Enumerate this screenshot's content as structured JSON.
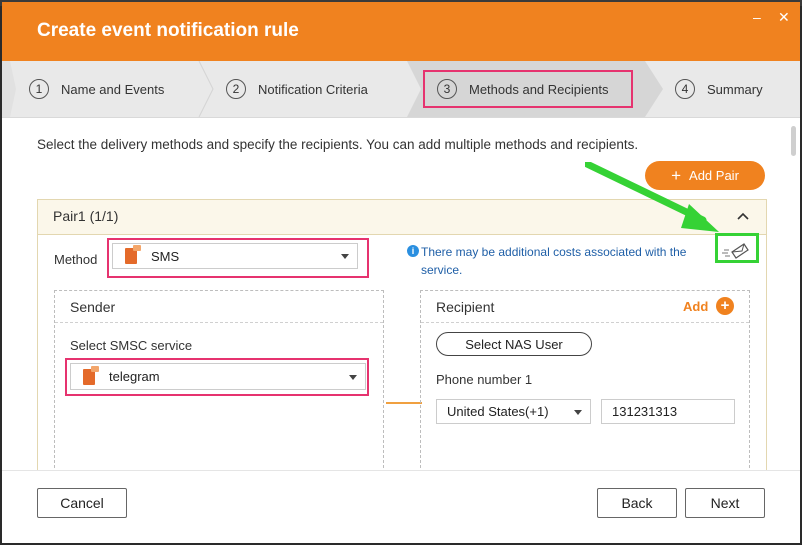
{
  "dialog": {
    "title": "Create event notification rule",
    "minimize_symbol": "–",
    "close_symbol": "✕"
  },
  "steps": [
    {
      "num": "1",
      "label": "Name and Events"
    },
    {
      "num": "2",
      "label": "Notification Criteria"
    },
    {
      "num": "3",
      "label": "Methods and Recipients"
    },
    {
      "num": "4",
      "label": "Summary"
    }
  ],
  "content": {
    "description": "Select the delivery methods and specify the recipients. You can add multiple methods and recipients.",
    "add_pair_label": "Add Pair",
    "pair": {
      "title": "Pair1 (1/1)",
      "method_label": "Method",
      "method_value": "SMS",
      "info_text": "There may be additional costs associated with the service.",
      "sender": {
        "heading": "Sender",
        "smsc_label": "Select SMSC service",
        "smsc_value": "telegram"
      },
      "recipient": {
        "heading": "Recipient",
        "add_label": "Add",
        "select_nas_user_label": "Select NAS User",
        "phone_label": "Phone number 1",
        "country_value": "United States(+1)",
        "phone_value": "131231313"
      }
    }
  },
  "footer": {
    "cancel_label": "Cancel",
    "back_label": "Back",
    "next_label": "Next"
  },
  "colors": {
    "accent": "#f0821f",
    "highlight": "#e6336f",
    "annotation": "#35d235",
    "info": "#1f5fa7"
  },
  "icons": {
    "send_test": "envelope-send-icon",
    "info": "info-icon",
    "method": "sms-sim-icon",
    "collapse": "chevron-up-icon",
    "add": "plus-icon"
  }
}
